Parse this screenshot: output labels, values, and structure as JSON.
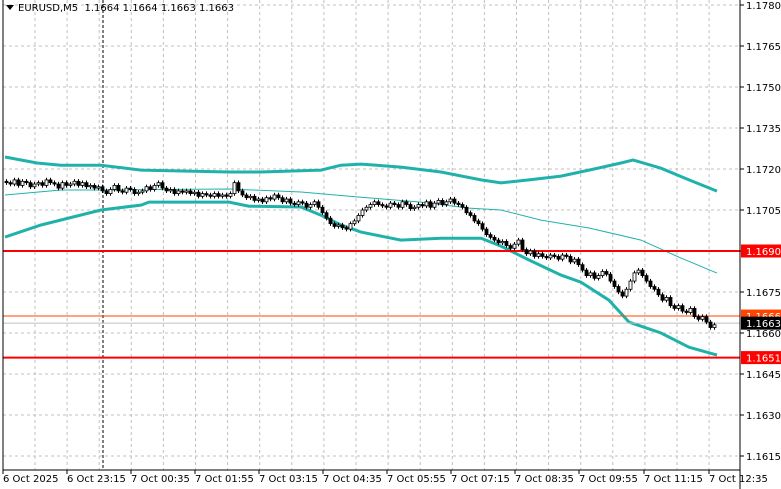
{
  "header": {
    "symbol": "EURUSD,M5",
    "ohlc": "1.1664 1.1664 1.1663 1.1663"
  },
  "colors": {
    "bull_body": "#ffffff",
    "bear_body": "#000000",
    "band": "#20b2aa",
    "level": "#ff0000",
    "ask_line": "#ff4500",
    "bid_line": "#c0c0c0",
    "grid": "#c0c0c0"
  },
  "chart_data": {
    "type": "candlestick",
    "title": "EURUSD,M5",
    "timeframe_minutes": 5,
    "ylim": [
      1.161,
      1.1782
    ],
    "grid": true,
    "y_ticks": [
      "1.1780",
      "1.1765",
      "1.1750",
      "1.1735",
      "1.1720",
      "1.1705",
      "1.1690",
      "1.1675",
      "1.1660",
      "1.1645",
      "1.1630",
      "1.1615"
    ],
    "x_ticks": [
      {
        "label": "6 Oct 2025",
        "index": -0.5
      },
      {
        "label": "6 Oct 23:15",
        "index": 15.5
      },
      {
        "label": "7 Oct 00:35",
        "index": 31.5
      },
      {
        "label": "7 Oct 01:55",
        "index": 47.5
      },
      {
        "label": "7 Oct 03:15",
        "index": 63.5
      },
      {
        "label": "7 Oct 04:35",
        "index": 79.5
      },
      {
        "label": "7 Oct 05:55",
        "index": 95.5
      },
      {
        "label": "7 Oct 07:15",
        "index": 111.5
      },
      {
        "label": "7 Oct 08:35",
        "index": 127.5
      },
      {
        "label": "7 Oct 09:55",
        "index": 143.5
      },
      {
        "label": "7 Oct 11:15",
        "index": 159.75
      },
      {
        "label": "7 Oct 12:35",
        "index": 176
      }
    ],
    "crosshair_index": 24,
    "closes": [
      1.1715,
      1.17145,
      1.1716,
      1.1714,
      1.17155,
      1.1715,
      1.17135,
      1.17145,
      1.1715,
      1.1714,
      1.1716,
      1.1715,
      1.17145,
      1.1713,
      1.1715,
      1.1714,
      1.17145,
      1.17155,
      1.1714,
      1.1715,
      1.17135,
      1.1714,
      1.1713,
      1.17135,
      1.1712,
      1.1711,
      1.17125,
      1.1714,
      1.1712,
      1.17115,
      1.1713,
      1.17125,
      1.1711,
      1.17115,
      1.1712,
      1.17135,
      1.17125,
      1.1714,
      1.1715,
      1.1713,
      1.1712,
      1.17125,
      1.1711,
      1.1712,
      1.17115,
      1.1712,
      1.1711,
      1.17115,
      1.171,
      1.1711,
      1.17105,
      1.171,
      1.1711,
      1.171,
      1.17105,
      1.171,
      1.1711,
      1.1715,
      1.1712,
      1.17105,
      1.17095,
      1.171,
      1.17085,
      1.1709,
      1.1708,
      1.17095,
      1.1709,
      1.17105,
      1.17095,
      1.1708,
      1.1709,
      1.17075,
      1.1707,
      1.1708,
      1.17075,
      1.1706,
      1.1707,
      1.1708,
      1.1706,
      1.1704,
      1.1702,
      1.17,
      1.1699,
      1.16995,
      1.16985,
      1.1698,
      1.17,
      1.1701,
      1.1703,
      1.1705,
      1.1706,
      1.1707,
      1.1708,
      1.1707,
      1.17065,
      1.1706,
      1.17075,
      1.1707,
      1.1706,
      1.1708,
      1.1707,
      1.17055,
      1.1706,
      1.1707,
      1.17065,
      1.1708,
      1.1706,
      1.17075,
      1.17085,
      1.1707,
      1.1708,
      1.1709,
      1.17075,
      1.1707,
      1.1706,
      1.1704,
      1.1703,
      1.1701,
      1.17,
      1.1698,
      1.1696,
      1.1695,
      1.1694,
      1.1693,
      1.16935,
      1.1692,
      1.1691,
      1.16925,
      1.1694,
      1.16905,
      1.1689,
      1.169,
      1.1688,
      1.1689,
      1.1688,
      1.16875,
      1.16885,
      1.1688,
      1.1687,
      1.16885,
      1.1688,
      1.1686,
      1.1687,
      1.1685,
      1.1683,
      1.1681,
      1.1682,
      1.168,
      1.1681,
      1.16825,
      1.16815,
      1.1679,
      1.1677,
      1.1675,
      1.16735,
      1.1676,
      1.1679,
      1.1682,
      1.1683,
      1.1681,
      1.1679,
      1.1677,
      1.1676,
      1.1674,
      1.1672,
      1.1673,
      1.167,
      1.1669,
      1.167,
      1.1668,
      1.16675,
      1.1669,
      1.1666,
      1.1665,
      1.1666,
      1.1664,
      1.1662,
      1.1663
    ],
    "bollinger": {
      "upper": [
        [
          0,
          1.17244
        ],
        [
          8,
          1.17222
        ],
        [
          14,
          1.17214
        ],
        [
          24,
          1.17214
        ],
        [
          34,
          1.17196
        ],
        [
          56,
          1.17189
        ],
        [
          64,
          1.17189
        ],
        [
          79,
          1.17196
        ],
        [
          84,
          1.17214
        ],
        [
          89,
          1.17218
        ],
        [
          99,
          1.17207
        ],
        [
          109,
          1.17189
        ],
        [
          119,
          1.1716
        ],
        [
          124,
          1.17149
        ],
        [
          131,
          1.1716
        ],
        [
          139,
          1.17174
        ],
        [
          146,
          1.17196
        ],
        [
          154,
          1.17222
        ],
        [
          157,
          1.17233
        ],
        [
          164,
          1.17203
        ],
        [
          171,
          1.1716
        ],
        [
          178,
          1.17119
        ]
      ],
      "middle": [
        [
          0,
          1.17105
        ],
        [
          14,
          1.17123
        ],
        [
          24,
          1.17123
        ],
        [
          56,
          1.17127
        ],
        [
          74,
          1.17116
        ],
        [
          89,
          1.17097
        ],
        [
          104,
          1.17079
        ],
        [
          116,
          1.17057
        ],
        [
          124,
          1.1705
        ],
        [
          134,
          1.17013
        ],
        [
          146,
          1.16984
        ],
        [
          159,
          1.1694
        ],
        [
          169,
          1.16874
        ],
        [
          178,
          1.16819
        ]
      ],
      "lower": [
        [
          0,
          1.16951
        ],
        [
          9,
          1.16995
        ],
        [
          24,
          1.1705
        ],
        [
          34,
          1.17068
        ],
        [
          36,
          1.17079
        ],
        [
          56,
          1.17079
        ],
        [
          61,
          1.17064
        ],
        [
          74,
          1.17061
        ],
        [
          79,
          1.17031
        ],
        [
          84,
          1.16995
        ],
        [
          89,
          1.16969
        ],
        [
          99,
          1.1694
        ],
        [
          109,
          1.16947
        ],
        [
          119,
          1.16947
        ],
        [
          124,
          1.16918
        ],
        [
          131,
          1.16867
        ],
        [
          139,
          1.16812
        ],
        [
          144,
          1.16786
        ],
        [
          151,
          1.1672
        ],
        [
          156,
          1.1664
        ],
        [
          164,
          1.166
        ],
        [
          171,
          1.16548
        ],
        [
          178,
          1.16519
        ]
      ]
    },
    "levels": [
      {
        "label": "1.1690",
        "price": 1.169,
        "kind": "resistance"
      },
      {
        "label": "1.1651",
        "price": 1.1651,
        "kind": "support"
      }
    ],
    "ask": {
      "label": "1.1666",
      "price": 1.16662
    },
    "bid": {
      "label": "1.1663",
      "price": 1.16636
    }
  }
}
